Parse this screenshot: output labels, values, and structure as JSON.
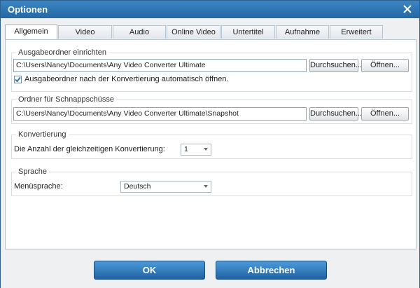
{
  "window": {
    "title": "Optionen"
  },
  "tabs": [
    {
      "label": "Allgemein"
    },
    {
      "label": "Video"
    },
    {
      "label": "Audio"
    },
    {
      "label": "Online Video"
    },
    {
      "label": "Untertitel"
    },
    {
      "label": "Aufnahme"
    },
    {
      "label": "Erweitert"
    }
  ],
  "active_tab": "Allgemein",
  "output": {
    "title": "Ausgabeordner einrichten",
    "path": "C:\\Users\\Nancy\\Documents\\Any Video Converter Ultimate",
    "browse": "Durchsuchen...",
    "open": "Öffnen...",
    "auto_open_label": "Ausgabeordner nach der Konvertierung automatisch öffnen.",
    "auto_open_checked": true
  },
  "snapshot": {
    "title": "Ordner für Schnappschüsse",
    "path": "C:\\Users\\Nancy\\Documents\\Any Video Converter Ultimate\\Snapshot",
    "browse": "Durchsuchen...",
    "open": "Öffnen..."
  },
  "conversion": {
    "title": "Konvertierung",
    "label": "Die Anzahl der gleichzeitigen Konvertierung:",
    "value": "1"
  },
  "language": {
    "title": "Sprache",
    "label": "Menüsprache:",
    "value": "Deutsch"
  },
  "footer": {
    "ok": "OK",
    "cancel": "Abbrechen"
  },
  "colors": {
    "title_bar": "#2467a4",
    "button": "#1f62a2",
    "check": "#2a6fb0"
  },
  "icons": {
    "close": "close-icon",
    "check": "check-icon",
    "dropdown": "chevron-down-icon"
  }
}
